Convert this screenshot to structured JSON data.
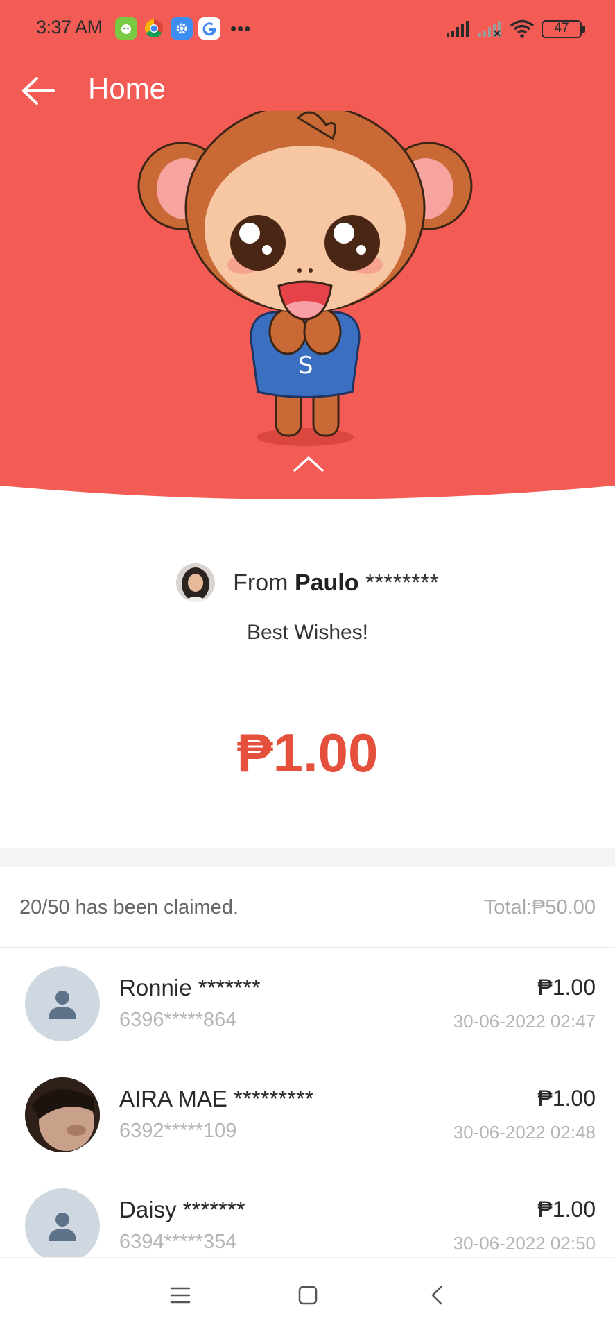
{
  "status_bar": {
    "time": "3:37 AM",
    "more": "•••",
    "battery": "47",
    "icons": [
      "dog-app-icon",
      "chrome-icon",
      "settings-app-icon",
      "google-icon",
      "signal-icon",
      "signal-no-icon",
      "wifi-icon",
      "battery-icon"
    ]
  },
  "nav": {
    "title": "Home"
  },
  "sender": {
    "prefix": "From",
    "name": "Paulo",
    "masked": "********",
    "greeting": "Best Wishes!"
  },
  "amount": "₱1.00",
  "claims": {
    "summary": "20/50 has been claimed.",
    "total": "Total:₱50.00",
    "rows": [
      {
        "name": "Ronnie *******",
        "phone": "6396*****864",
        "amount": "₱1.00",
        "date": "30-06-2022 02:47",
        "avatar": "default"
      },
      {
        "name": "AIRA MAE *********",
        "phone": "6392*****109",
        "amount": "₱1.00",
        "date": "30-06-2022 02:48",
        "avatar": "photo"
      },
      {
        "name": "Daisy *******",
        "phone": "6394*****354",
        "amount": "₱1.00",
        "date": "30-06-2022 02:50",
        "avatar": "default"
      }
    ]
  },
  "colors": {
    "header_red": "#f25c55",
    "amount_red": "#e4503c",
    "avatar_placeholder": "#cfd8e0",
    "avatar_glyph": "#5c7389"
  }
}
